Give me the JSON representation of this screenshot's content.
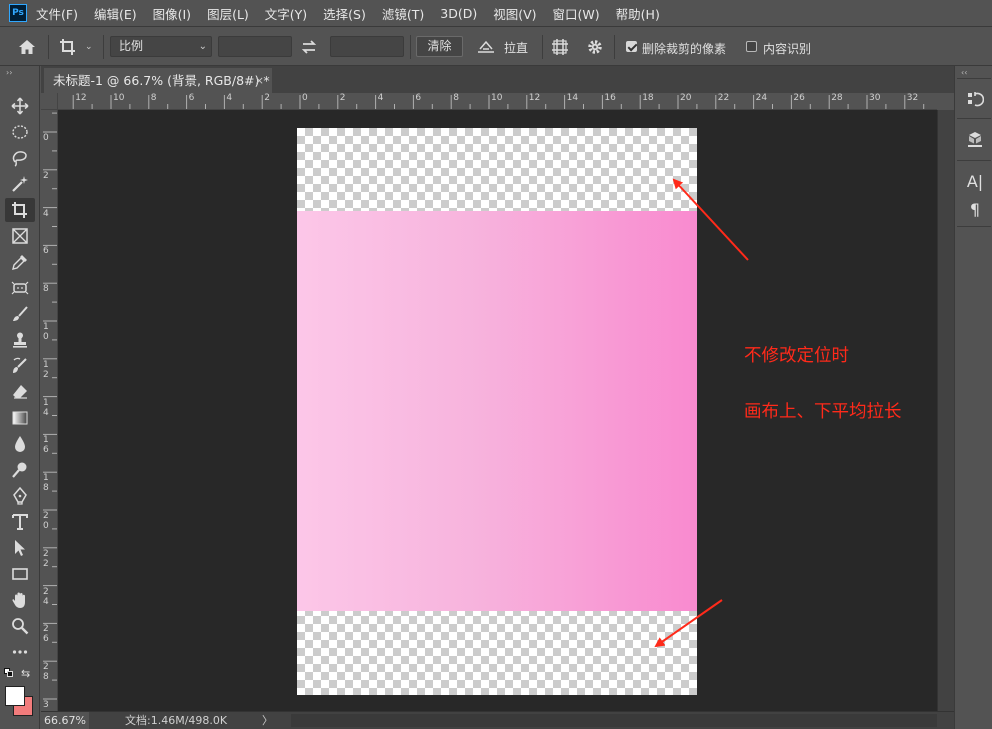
{
  "menubar": {
    "logo": "Ps",
    "items": [
      "文件(F)",
      "编辑(E)",
      "图像(I)",
      "图层(L)",
      "文字(Y)",
      "选择(S)",
      "滤镜(T)",
      "3D(D)",
      "视图(V)",
      "窗口(W)",
      "帮助(H)"
    ]
  },
  "options": {
    "ratio_value": "比例",
    "width_value": "",
    "height_value": "",
    "clear_label": "清除",
    "straighten_label": "拉直",
    "delete_cropped_label": "删除裁剪的像素",
    "delete_cropped_checked": true,
    "content_aware_label": "内容识别",
    "content_aware_checked": false
  },
  "document": {
    "tab_title": "未标题-1 @ 66.7% (背景, RGB/8#) *",
    "close_glyph": "×"
  },
  "rulers": {
    "h_labels": [
      "12",
      "10",
      "8",
      "6",
      "4",
      "2",
      "0",
      "2",
      "4",
      "6",
      "8",
      "10",
      "12",
      "14",
      "16",
      "18",
      "20",
      "22",
      "24",
      "26",
      "28",
      "30",
      "32"
    ],
    "v_labels": [
      "0",
      "2",
      "4",
      "6",
      "8",
      "1 0",
      "1 2",
      "1 4",
      "1 6",
      "1 8",
      "2 0",
      "2 2",
      "2 4",
      "2 6",
      "2 8",
      "3"
    ]
  },
  "annotations": {
    "line1": "不修改定位时",
    "line2": "画布上、下平均拉长"
  },
  "status": {
    "zoom": "66.67%",
    "doc_info": "文档:1.46M/498.0K",
    "arrow": "〉"
  },
  "colors": {
    "gradient_left": "#fcc7e8",
    "gradient_right": "#f98acf",
    "annotation": "#ff2a1a",
    "workspace": "#282828"
  },
  "icons": {
    "toolbar": [
      "move-icon",
      "ellipse-marquee-icon",
      "lasso-icon",
      "magic-wand-icon",
      "crop-icon",
      "frame-icon",
      "eyedropper-icon",
      "healing-brush-icon",
      "brush-icon",
      "stamp-icon",
      "history-brush-icon",
      "eraser-icon",
      "gradient-icon",
      "blur-icon",
      "dodge-icon",
      "pen-icon",
      "type-icon",
      "path-selection-icon",
      "rectangle-icon",
      "hand-icon",
      "zoom-icon",
      "more-icon"
    ]
  }
}
